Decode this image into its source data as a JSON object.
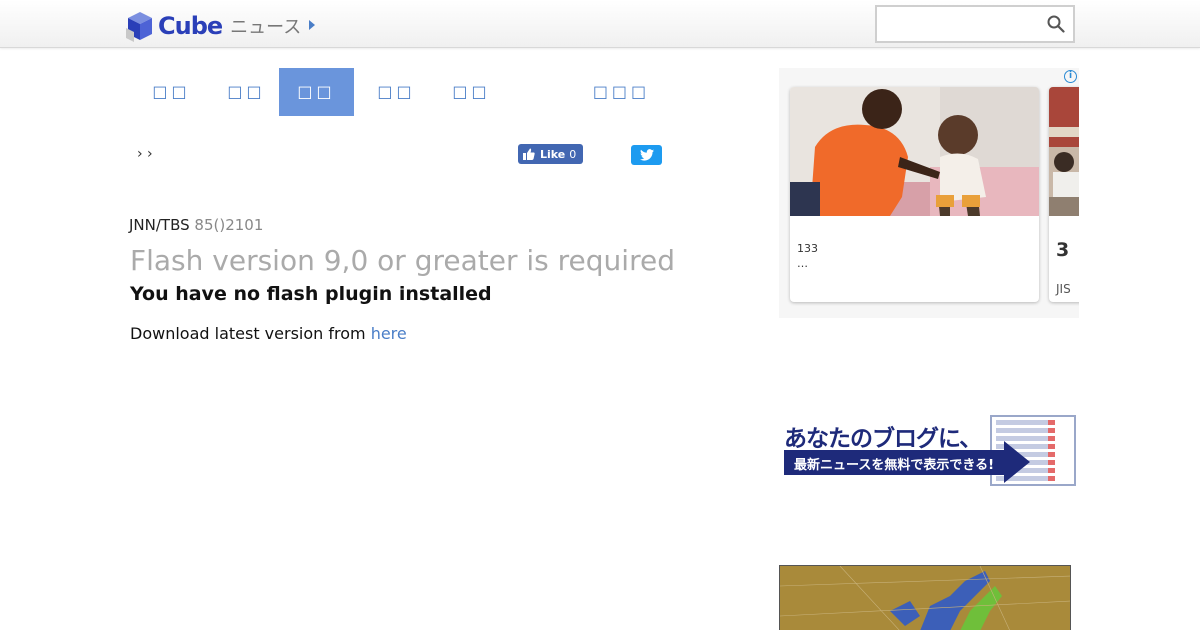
{
  "header": {
    "logo_text": "Cube",
    "logo_sub": "ニュース",
    "search_placeholder": ""
  },
  "tabs": [
    {
      "label": "□□",
      "active": false
    },
    {
      "label": "□□",
      "active": false
    },
    {
      "label": "□□",
      "active": true
    },
    {
      "label": "□□",
      "active": false
    },
    {
      "label": "□□",
      "active": false
    },
    {
      "label": "□□□",
      "active": false
    }
  ],
  "breadcrumb": "› ›",
  "social": {
    "fb_like_label": "Like",
    "fb_like_count": "0"
  },
  "article": {
    "source": "JNN/TBS",
    "meta": "85()2101",
    "flash_title": "Flash version 9,0 or greater is required",
    "flash_subtitle": "You have no flash plugin installed",
    "download_prefix": "Download latest version from ",
    "download_link": "here"
  },
  "ad": {
    "info_icon": "i",
    "card1_text_line1": "133",
    "card1_text_line2": "…",
    "card2_number": "3",
    "card2_source": "JIS"
  },
  "blog_banner": {
    "line1": "あなたのブログに、",
    "line2": "最新ニュースを無料で表示できる!"
  },
  "colors": {
    "accent": "#4a7ec7",
    "tab_active_bg": "#6a95dc",
    "logo": "#2a3fb8",
    "facebook": "#4267b2",
    "twitter": "#1d9bf0"
  }
}
